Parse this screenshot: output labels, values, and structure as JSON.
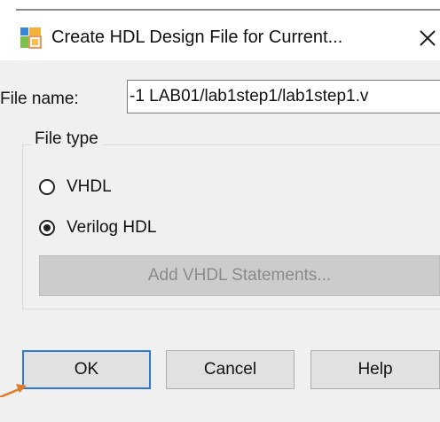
{
  "window": {
    "title": "Create HDL Design File for Current...",
    "icon": "quartus-file-icon",
    "close_icon": "close-icon"
  },
  "file_name": {
    "label": "File name:",
    "value": "-1 LAB01/lab1step1/lab1step1.v"
  },
  "file_type": {
    "label": "File type",
    "options": [
      {
        "label": "VHDL",
        "checked": false
      },
      {
        "label": "Verilog HDL",
        "checked": true
      }
    ],
    "add_statements_label": "Add VHDL Statements...",
    "add_statements_enabled": false
  },
  "buttons": {
    "ok": "OK",
    "cancel": "Cancel",
    "help": "Help"
  },
  "colors": {
    "dialog_bg": "#f0f0f0",
    "default_button_border": "#2f78d4",
    "callout_arrow": "#e07b2a"
  }
}
